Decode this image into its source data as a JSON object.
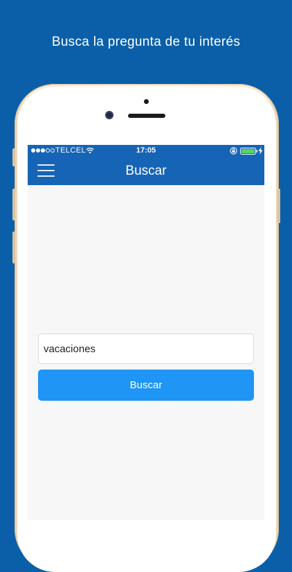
{
  "promo": {
    "caption": "Busca la pregunta de tu interés"
  },
  "status_bar": {
    "carrier": "TELCEL",
    "time": "17:05",
    "signal_strength": 3,
    "signal_max": 5,
    "battery_level": 1.0
  },
  "nav": {
    "title": "Buscar",
    "menu_icon": "hamburger-menu-icon"
  },
  "search": {
    "value": "vacaciones",
    "placeholder": "",
    "button_label": "Buscar"
  },
  "colors": {
    "background": "#0a5fa8",
    "nav_bar": "#1664b5",
    "button": "#1f95f5",
    "screen": "#f7f7f7",
    "battery": "#4cd964"
  }
}
